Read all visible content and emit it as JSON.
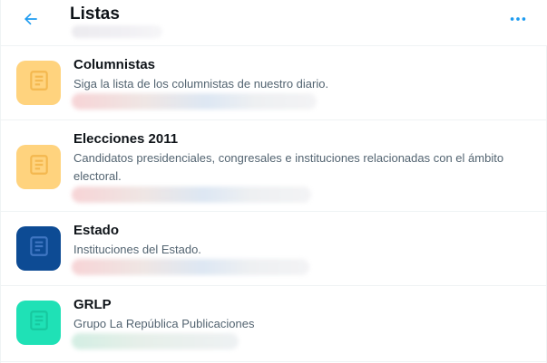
{
  "header": {
    "title": "Listas",
    "back_icon": "arrow-left-icon",
    "more_icon": "more-dots-icon",
    "accent_color": "#1d9bf0"
  },
  "lists": [
    {
      "name": "Columnistas",
      "description": "Siga la lista de los columnistas de nuestro diario.",
      "thumb_color": "#ffd37e",
      "icon_color": "#f4b84f",
      "icon": "list-document-icon"
    },
    {
      "name": "Elecciones 2011",
      "description": "Candidatos presidenciales, congresales e instituciones relacionadas con el ámbito electoral.",
      "thumb_color": "#ffd37e",
      "icon_color": "#f4b84f",
      "icon": "list-document-icon"
    },
    {
      "name": "Estado",
      "description": "Instituciones del Estado.",
      "thumb_color": "#0d4b94",
      "icon_color": "#3f76c2",
      "icon": "list-document-icon"
    },
    {
      "name": "GRLP",
      "description": "Grupo La República Publicaciones",
      "thumb_color": "#1fe1b6",
      "icon_color": "#17c89f",
      "icon": "list-document-icon"
    }
  ]
}
